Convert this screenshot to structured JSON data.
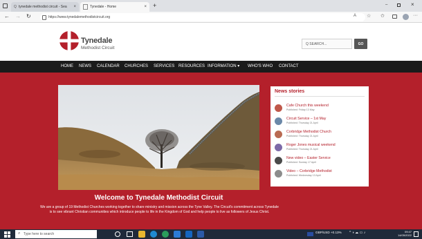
{
  "browser": {
    "tabs": [
      {
        "label": "tynedale methodist circuit - Sea"
      },
      {
        "label": "Tynedale - Home"
      }
    ],
    "new_tab_label": "+",
    "url": "https://www.tynedalemethodistcircuit.org"
  },
  "site": {
    "title": "Tynedale",
    "subtitle": "Methodist Circuit",
    "search_placeholder": "Q SEARCH...",
    "search_button": "GO"
  },
  "nav": {
    "items": [
      "HOME",
      "NEWS",
      "CALENDAR",
      "CHURCHES",
      "SERVICES",
      "RESOURCES",
      "INFORMATION ▾",
      "WHO'S WHO",
      "CONTACT"
    ]
  },
  "hero": {
    "heading": "Welcome to Tynedale Methodist Circuit",
    "intro": "We are a group of 19 Methodist Churches working together to share ministry and mission across the Tyne Valley. The Circuit's commitment across Tynedale is to see vibrant Christian communities which introduce people to life in the Kingdom of God and help people to live as followers of Jesus Christ."
  },
  "news": {
    "title": "News stories",
    "items": [
      {
        "title": "Cafe Church this weekend",
        "date": "Published: Friday 13 May"
      },
      {
        "title": "Circuit Service – 1st May",
        "date": "Published: Thursday 21 April"
      },
      {
        "title": "Corbridge Methodist Church",
        "date": "Published: Thursday 21 April"
      },
      {
        "title": "Roger Jones musical weekend",
        "date": "Published: Thursday 21 April"
      },
      {
        "title": "New video – Easter Service",
        "date": "Published: Sunday 17 April"
      },
      {
        "title": "Video – Corbridge Methodist",
        "date": "Published: Wednesday 13 April"
      }
    ]
  },
  "taskbar": {
    "search_placeholder": "Type here to search",
    "tray_text": "GBP/USD +0.13%",
    "time": "09:47",
    "date": "14/05/2022"
  },
  "colors": {
    "brand_red": "#b4202b",
    "nav_bg": "#1b1b1b",
    "taskbar_bg": "#1f2a3a"
  }
}
